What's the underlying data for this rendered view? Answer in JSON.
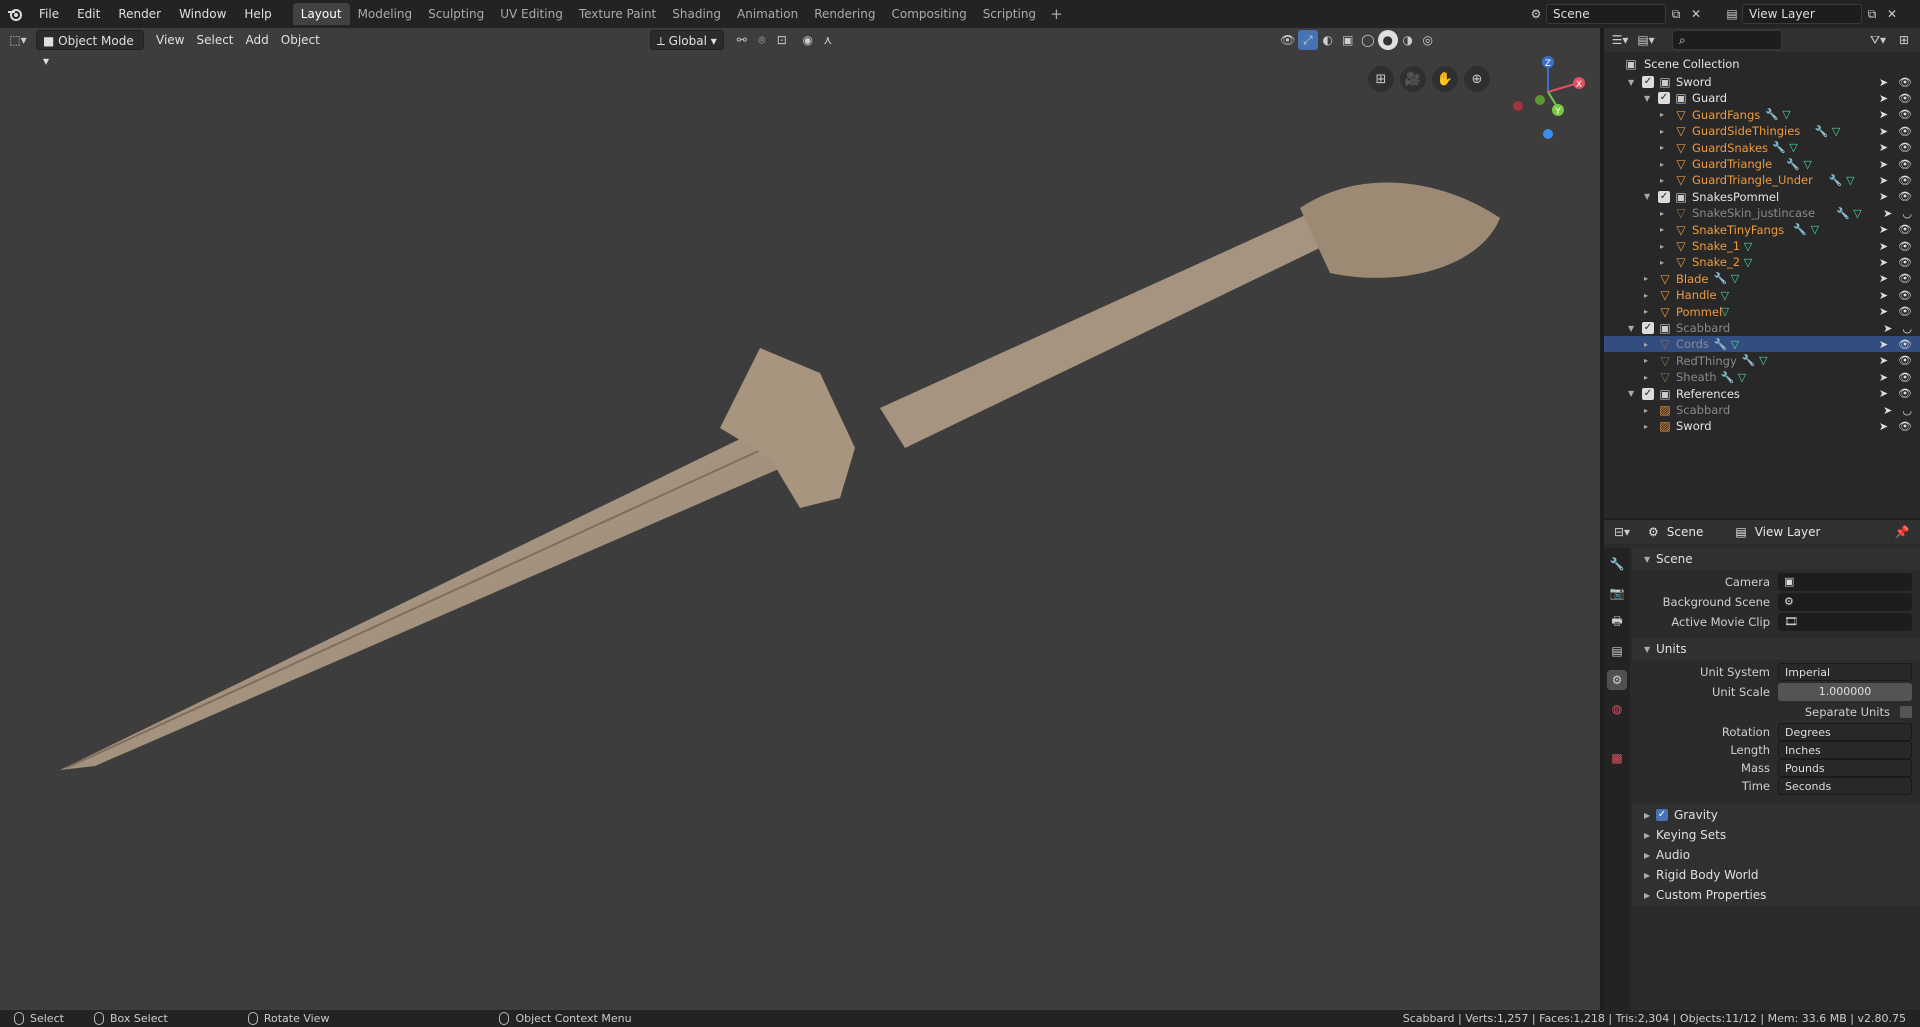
{
  "menu": [
    "File",
    "Edit",
    "Render",
    "Window",
    "Help"
  ],
  "workspaces": [
    "Layout",
    "Modeling",
    "Sculpting",
    "UV Editing",
    "Texture Paint",
    "Shading",
    "Animation",
    "Rendering",
    "Compositing",
    "Scripting"
  ],
  "scene_name": "Scene",
  "view_layer_name": "View Layer",
  "viewport": {
    "mode": "Object Mode",
    "menus": [
      "View",
      "Select",
      "Add",
      "Object"
    ],
    "orientation": "Global",
    "gizmo_axes": {
      "x": "X",
      "y": "Y",
      "z": "Z"
    }
  },
  "outliner": {
    "root": "Scene Collection",
    "rows": [
      {
        "name": "Sword",
        "kind": "collection",
        "depth": 0,
        "checked": true
      },
      {
        "name": "Guard",
        "kind": "collection",
        "depth": 1,
        "checked": true
      },
      {
        "name": "GuardFangs",
        "kind": "object",
        "depth": 2,
        "mods": "wrench+mesh",
        "tone": "orange"
      },
      {
        "name": "GuardSideThingies",
        "kind": "object",
        "depth": 2,
        "mods": "wrench+mesh",
        "tone": "orange"
      },
      {
        "name": "GuardSnakes",
        "kind": "object",
        "depth": 2,
        "mods": "wrench+mesh",
        "tone": "orange"
      },
      {
        "name": "GuardTriangle",
        "kind": "object",
        "depth": 2,
        "mods": "wrench+mesh",
        "tone": "orange"
      },
      {
        "name": "GuardTriangle_Under",
        "kind": "object",
        "depth": 2,
        "mods": "wrench+mesh",
        "tone": "orange"
      },
      {
        "name": "SnakesPommel",
        "kind": "collection",
        "depth": 1,
        "checked": true
      },
      {
        "name": "SnakeSkin_justincase",
        "kind": "object",
        "depth": 2,
        "mods": "wrench+mesh",
        "tone": "dim"
      },
      {
        "name": "SnakeTinyFangs",
        "kind": "object",
        "depth": 2,
        "mods": "wrench+mesh",
        "tone": "orange"
      },
      {
        "name": "Snake_1",
        "kind": "object",
        "depth": 2,
        "mods": "mesh",
        "tone": "orange"
      },
      {
        "name": "Snake_2",
        "kind": "object",
        "depth": 2,
        "mods": "mesh",
        "tone": "orange"
      },
      {
        "name": "Blade",
        "kind": "object",
        "depth": 1,
        "mods": "wrench+mesh",
        "tone": "orange"
      },
      {
        "name": "Handle",
        "kind": "object",
        "depth": 1,
        "mods": "mesh",
        "tone": "orange"
      },
      {
        "name": "Pommel",
        "kind": "object",
        "depth": 1,
        "mods": "mesh",
        "tone": "orange"
      },
      {
        "name": "Scabbard",
        "kind": "collection",
        "depth": 0,
        "checked": true,
        "tone": "dim"
      },
      {
        "name": "Cords",
        "kind": "object",
        "depth": 1,
        "mods": "wrench+mesh",
        "tone": "dim",
        "selected": true
      },
      {
        "name": "RedThingy",
        "kind": "object",
        "depth": 1,
        "mods": "wrench+mesh",
        "tone": "dim"
      },
      {
        "name": "Sheath",
        "kind": "object",
        "depth": 1,
        "mods": "wrench+mesh",
        "tone": "dim"
      },
      {
        "name": "References",
        "kind": "collection",
        "depth": 0,
        "checked": true
      },
      {
        "name": "Scabbard",
        "kind": "image",
        "depth": 1,
        "tone": "dim"
      },
      {
        "name": "Sword",
        "kind": "image",
        "depth": 1,
        "tone": "normal"
      }
    ]
  },
  "properties": {
    "header_scene": "Scene",
    "header_view_layer": "View Layer",
    "scene_panel": {
      "title": "Scene",
      "camera_label": "Camera",
      "background_label": "Background Scene",
      "clip_label": "Active Movie Clip"
    },
    "units_panel": {
      "title": "Units",
      "unit_system_label": "Unit System",
      "unit_system": "Imperial",
      "unit_scale_label": "Unit Scale",
      "unit_scale": "1.000000",
      "separate_units_label": "Separate Units",
      "rotation_label": "Rotation",
      "rotation": "Degrees",
      "length_label": "Length",
      "length": "Inches",
      "mass_label": "Mass",
      "mass": "Pounds",
      "time_label": "Time",
      "time": "Seconds"
    },
    "collapsed_panels": [
      "Gravity",
      "Keying Sets",
      "Audio",
      "Rigid Body World",
      "Custom Properties"
    ]
  },
  "statusbar": {
    "select": "Select",
    "box_select": "Box Select",
    "rotate": "Rotate View",
    "context": "Object Context Menu",
    "stats": "Scabbard | Verts:1,257 | Faces:1,218 | Tris:2,304 | Objects:11/12 | Mem: 33.6 MB | v2.80.75"
  },
  "colors": {
    "accent_selected": "#334d80",
    "object_orange": "#f09a3a",
    "mesh_green": "#4fd6a0",
    "wrench_blue": "#7fa8ff"
  }
}
